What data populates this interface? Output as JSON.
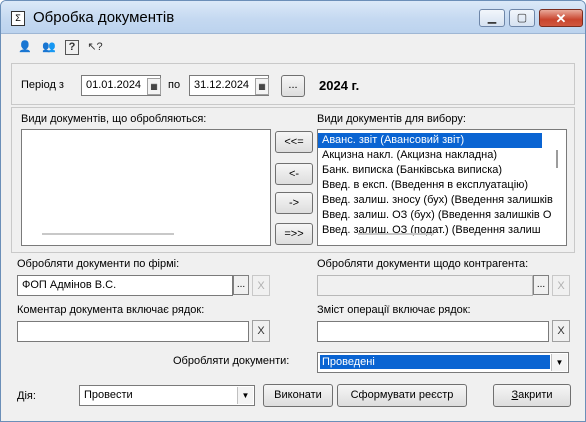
{
  "window": {
    "title": "Обробка документів",
    "minimize": "▁",
    "maximize": "▢",
    "close": "✕"
  },
  "period": {
    "label_from": "Період з",
    "date_from": "01.01.2024",
    "label_to": "по",
    "date_to": "31.12.2024",
    "more": "...",
    "year_text": "2024 г."
  },
  "left_list": {
    "label": "Види документів, що обробляються:",
    "items": []
  },
  "transfer": {
    "all_left": "<<=",
    "one_left": "<-",
    "one_right": "->",
    "all_right": "=>>"
  },
  "right_list": {
    "label": "Види документів для вибору:",
    "items": [
      "Аванс. звіт (Авансовий звіт)",
      "Акцизна накл. (Акцизна накладна)",
      "Банк. виписка (Банківська виписка)",
      "Введ. в експ. (Введення в експлуатацію)",
      "Введ. залиш. зносу (бух) (Введення залишків",
      "Введ. залиш. ОЗ (бух) (Введення залишків О",
      "Введ. залиш. ОЗ (подат.) (Введення залиш"
    ],
    "selected_index": 0
  },
  "firm": {
    "label": "Обробляти документи по фірмі:",
    "value": "ФОП Адмінов В.С.",
    "more": "...",
    "clear": "X"
  },
  "counterparty": {
    "label": "Обробляти документи щодо контрагента:",
    "value": "",
    "more": "...",
    "clear": "X"
  },
  "comment": {
    "label": "Коментар документа включає рядок:",
    "value": "",
    "clear": "X"
  },
  "operation": {
    "label": "Зміст операції включає рядок:",
    "value": "",
    "clear": "X"
  },
  "process": {
    "label": "Обробляти документи:",
    "value": "Проведені"
  },
  "action": {
    "label": "Дія:",
    "value": "Провести"
  },
  "buttons": {
    "execute": "Виконати",
    "register": "Сформувати реєстр",
    "close_prefix": "",
    "close_u": "З",
    "close_rest": "акрити"
  }
}
